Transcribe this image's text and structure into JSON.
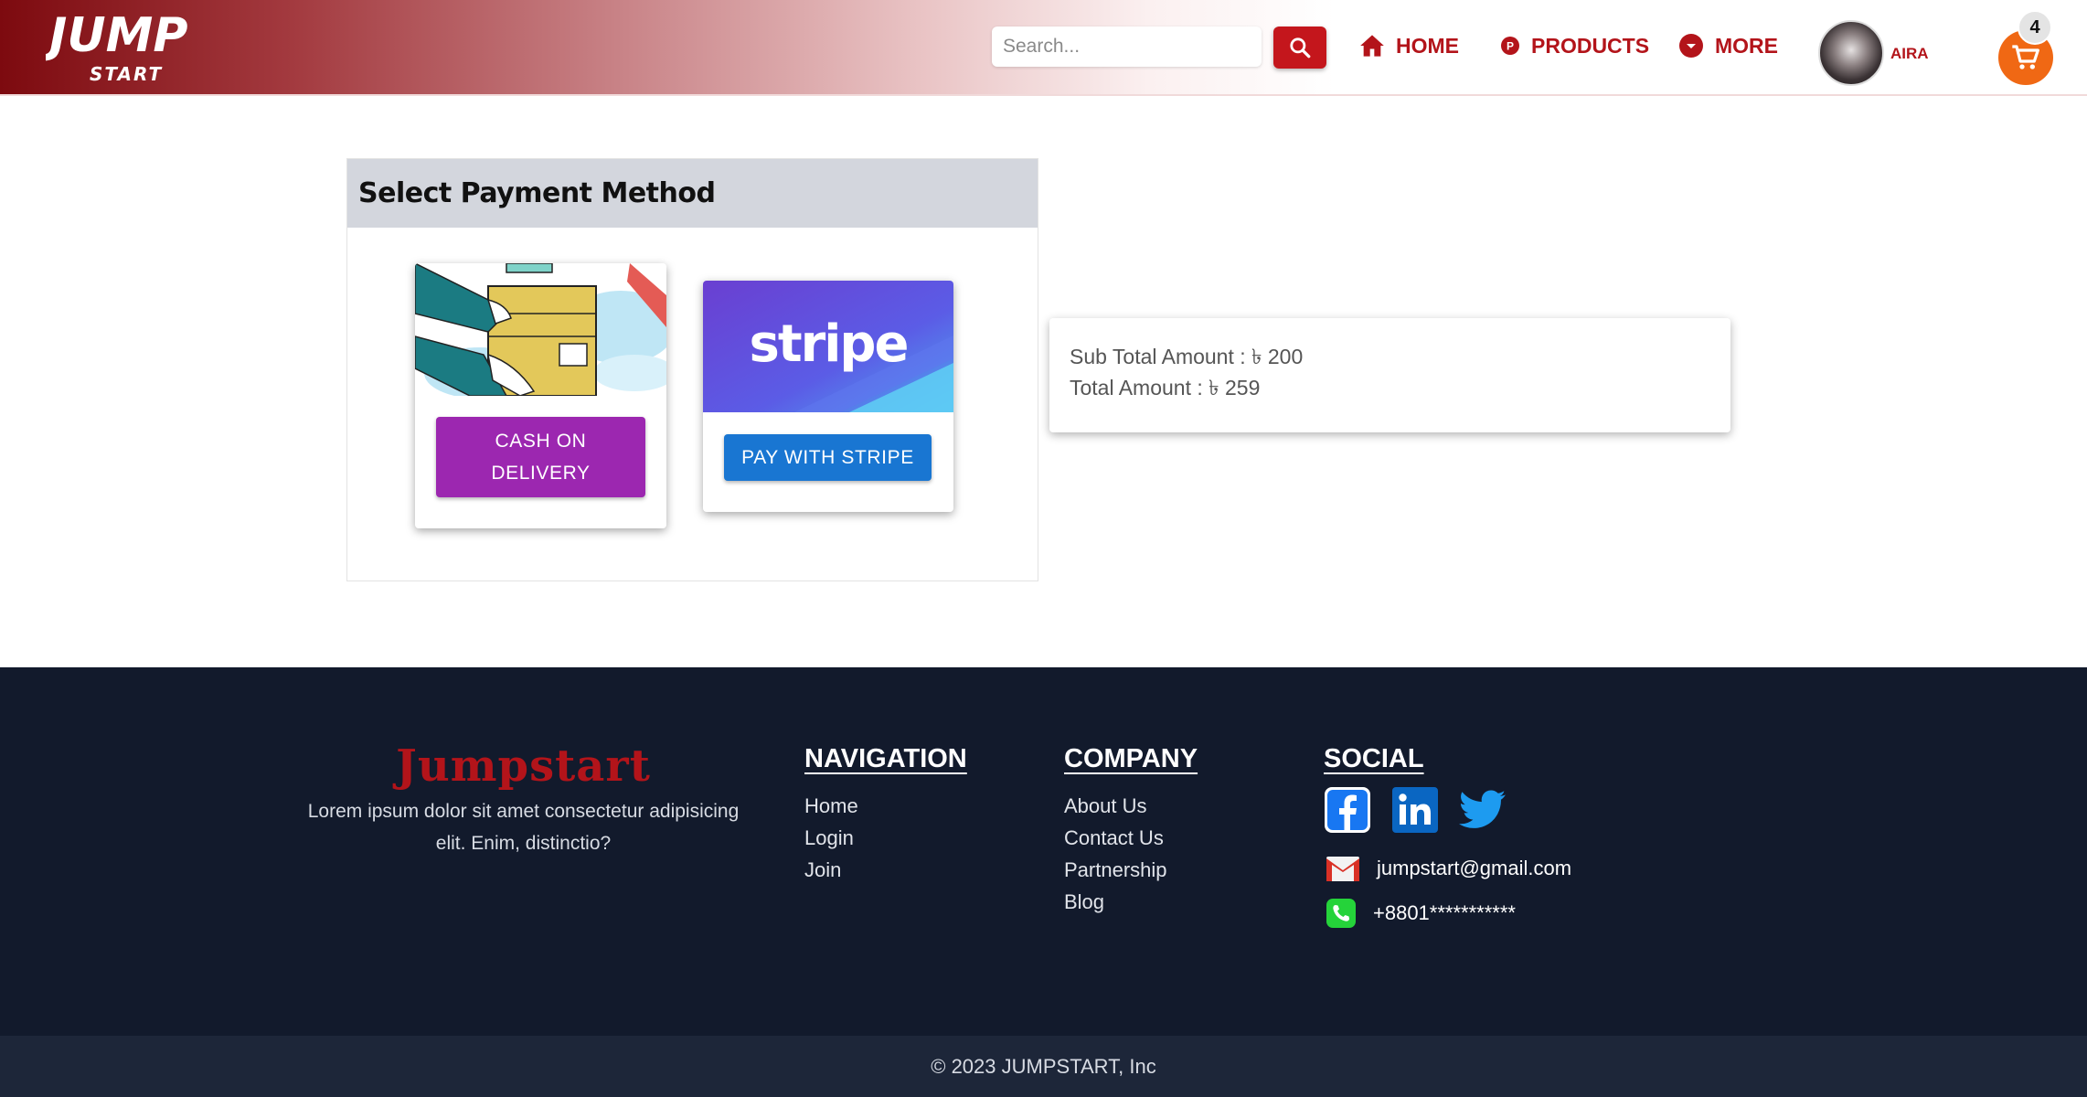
{
  "header": {
    "logo_text_top": "JUMP",
    "logo_text_bottom": "START",
    "search_placeholder": "Search...",
    "nav": {
      "home": "HOME",
      "products": "PRODUCTS",
      "more": "MORE"
    },
    "user_name": "AIRA",
    "cart_count": "4"
  },
  "payment": {
    "title": "Select Payment Method",
    "cod_button": "CASH ON DELIVERY",
    "stripe_logo_text": "stripe",
    "stripe_button": "PAY WITH STRIPE"
  },
  "summary": {
    "subtotal": "Sub Total Amount : ৳ 200",
    "total": "Total Amount : ৳ 259"
  },
  "footer": {
    "brand_name": "Jumpstart",
    "brand_desc": "Lorem ipsum dolor sit amet consectetur adipisicing elit. Enim, distinctio?",
    "navigation_title": "NAVIGATION",
    "navigation_links": [
      "Home",
      "Login",
      "Join"
    ],
    "company_title": "COMPANY",
    "company_links": [
      "About Us",
      "Contact Us",
      "Partnership",
      "Blog"
    ],
    "social_title": "SOCIAL",
    "email": "jumpstart@gmail.com",
    "phone": "+8801***********",
    "copyright": "© 2023 JUMPSTART, Inc"
  },
  "icons": {
    "search": "search-icon",
    "home": "home-icon",
    "products": "products-icon",
    "more": "chevron-down-icon",
    "cart": "cart-icon",
    "facebook": "facebook-icon",
    "linkedin": "linkedin-icon",
    "twitter": "twitter-icon",
    "mail": "mail-icon",
    "phone": "phone-icon"
  },
  "colors": {
    "brand_red": "#b3141a",
    "cod_purple": "#9c27b0",
    "stripe_blue": "#1976d2",
    "cart_orange": "#f06814",
    "footer_bg": "#121a2c"
  }
}
